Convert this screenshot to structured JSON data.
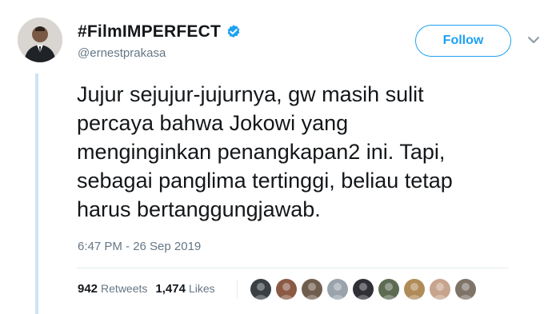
{
  "author": {
    "display_name": "#FilmIMPERFECT",
    "handle": "@ernestprakasa",
    "verified_icon": "verified-badge-icon",
    "avatar_icon": "user-avatar"
  },
  "actions": {
    "follow_label": "Follow",
    "menu_icon": "chevron-down-icon"
  },
  "tweet": {
    "text": "Jujur sejujur-jujurnya, gw masih sulit\npercaya bahwa Jokowi yang\nmenginginkan penangkapan2 ini. Tapi,\nsebagai panglima tertinggi, beliau tetap\nharus bertanggungjawab.",
    "timestamp": "6:47 PM - 26 Sep 2019"
  },
  "stats": {
    "retweets_count": "942",
    "retweets_label": "Retweets",
    "likes_count": "1,474",
    "likes_label": "Likes"
  },
  "likers": [
    {
      "icon": "liker-avatar-icon",
      "color": "#3a3f44"
    },
    {
      "icon": "liker-avatar-icon",
      "color": "#8a5a44"
    },
    {
      "icon": "liker-avatar-icon",
      "color": "#6f5d4e"
    },
    {
      "icon": "liker-avatar-icon",
      "color": "#9aa3ab"
    },
    {
      "icon": "liker-avatar-icon",
      "color": "#2f2f35"
    },
    {
      "icon": "liker-avatar-icon",
      "color": "#5d6b52"
    },
    {
      "icon": "liker-avatar-icon",
      "color": "#b08b58"
    },
    {
      "icon": "liker-avatar-icon",
      "color": "#c7a48d"
    },
    {
      "icon": "liker-avatar-icon",
      "color": "#7e7367"
    }
  ],
  "colors": {
    "brand": "#1da1f2",
    "text": "#14171a",
    "muted": "#657786",
    "thread_line": "#cfe3f3"
  }
}
